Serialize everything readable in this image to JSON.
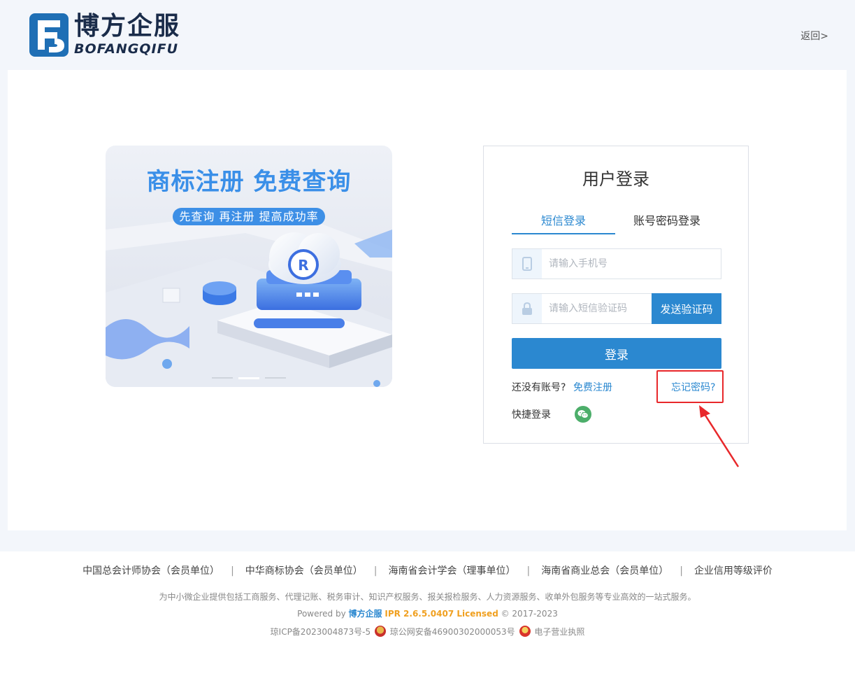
{
  "header": {
    "logo_cn": "博方企服",
    "logo_en": "BOFANGQIFU",
    "back_label": "返回>"
  },
  "banner": {
    "title": "商标注册  免费查询",
    "subtitle": "先查询 再注册 提高成功率",
    "carousel_active_index": 1,
    "carousel_count": 3
  },
  "login": {
    "title": "用户登录",
    "tabs": [
      {
        "label": "短信登录",
        "active": true
      },
      {
        "label": "账号密码登录",
        "active": false
      }
    ],
    "phone_placeholder": "请输入手机号",
    "code_placeholder": "请输入短信验证码",
    "send_code_label": "发送验证码",
    "submit_label": "登录",
    "no_account_text": "还没有账号?",
    "register_label": "免费注册",
    "forgot_label": "忘记密码?",
    "quick_login_label": "快捷登录"
  },
  "footer": {
    "partners": [
      "中国总会计师协会（会员单位）",
      "中华商标协会（会员单位）",
      "海南省会计学会（理事单位）",
      "海南省商业总会（会员单位）",
      "企业信用等级评价"
    ],
    "partner_separator": "|",
    "description": "为中小微企业提供包括工商服务、代理记账、税务审计、知识产权服务、报关报检服务、人力资源服务、收单外包服务等专业高效的一站式服务。",
    "powered_prefix": "Powered by",
    "powered_brand": "博方企服",
    "powered_version": "IPR 2.6.5.0407 Licensed",
    "copyright": "© 2017-2023",
    "icp": "琼ICP备2023004873号-5",
    "police_record": "琼公网安备46900302000053号",
    "business_license": "电子营业执照"
  },
  "colors": {
    "accent": "#2b88d0",
    "annotation": "#e8282b",
    "version_orange": "#f0a020",
    "wechat_green": "#4cae6a"
  }
}
